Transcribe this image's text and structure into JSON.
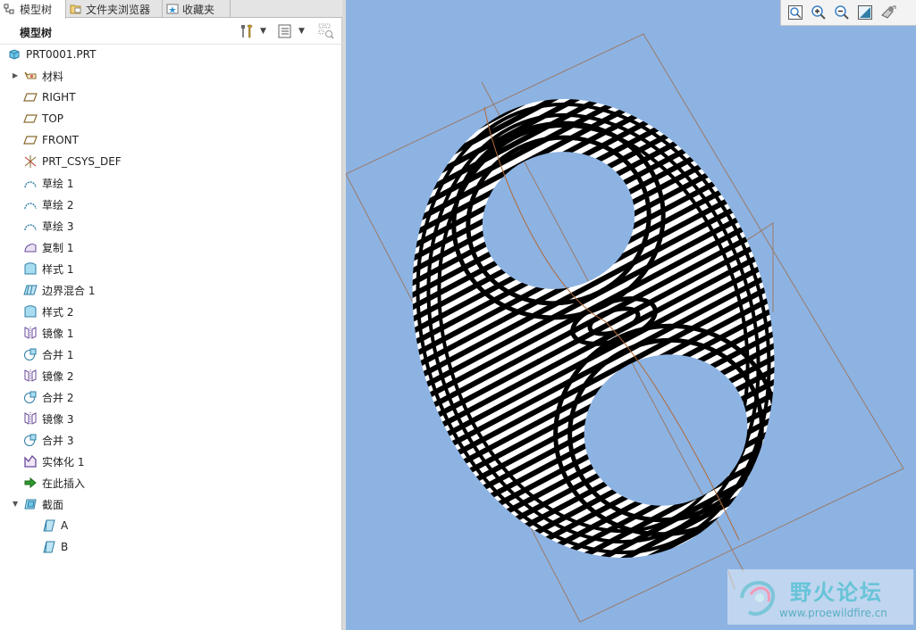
{
  "tabs": [
    {
      "label": "模型树",
      "active": true,
      "icon": "model-tree-icon"
    },
    {
      "label": "文件夹浏览器",
      "active": false,
      "icon": "folder-browser-icon"
    },
    {
      "label": "收藏夹",
      "active": false,
      "icon": "favorites-icon"
    }
  ],
  "tree_header": {
    "title": "模型树",
    "tools": [
      "settings-tools-icon",
      "show-icon",
      "filter-icon"
    ]
  },
  "tree": {
    "items": [
      {
        "label": "PRT0001.PRT",
        "icon": "part-icon"
      },
      {
        "label": "材料",
        "icon": "material-icon"
      },
      {
        "label": "RIGHT",
        "icon": "datum-plane-icon"
      },
      {
        "label": "TOP",
        "icon": "datum-plane-icon"
      },
      {
        "label": "FRONT",
        "icon": "datum-plane-icon"
      },
      {
        "label": "PRT_CSYS_DEF",
        "icon": "csys-icon"
      },
      {
        "label": "草绘 1",
        "icon": "sketch-icon"
      },
      {
        "label": "草绘 2",
        "icon": "sketch-icon"
      },
      {
        "label": "草绘 3",
        "icon": "sketch-icon"
      },
      {
        "label": "复制 1",
        "icon": "copy-icon"
      },
      {
        "label": "样式 1",
        "icon": "style-icon"
      },
      {
        "label": "边界混合 1",
        "icon": "boundary-blend-icon"
      },
      {
        "label": "样式 2",
        "icon": "style-icon"
      },
      {
        "label": "镜像 1",
        "icon": "mirror-icon"
      },
      {
        "label": "合并 1",
        "icon": "merge-icon"
      },
      {
        "label": "镜像 2",
        "icon": "mirror-icon"
      },
      {
        "label": "合并 2",
        "icon": "merge-icon"
      },
      {
        "label": "镜像 3",
        "icon": "mirror-icon"
      },
      {
        "label": "合并 3",
        "icon": "merge-icon"
      },
      {
        "label": "实体化 1",
        "icon": "solidify-icon"
      },
      {
        "label": "在此插入",
        "icon": "insert-here-icon"
      },
      {
        "label": "截面",
        "icon": "sections-icon"
      },
      {
        "label": "A",
        "icon": "section-icon"
      },
      {
        "label": "B",
        "icon": "section-icon"
      }
    ]
  },
  "viewport": {
    "background": "#8db3e2",
    "toolbar": [
      "refit-icon",
      "zoom-in-icon",
      "zoom-out-icon",
      "repaint-icon",
      "display-style-icon"
    ]
  },
  "watermark": {
    "title": "野火论坛",
    "url": "www.proewildfire.cn"
  }
}
